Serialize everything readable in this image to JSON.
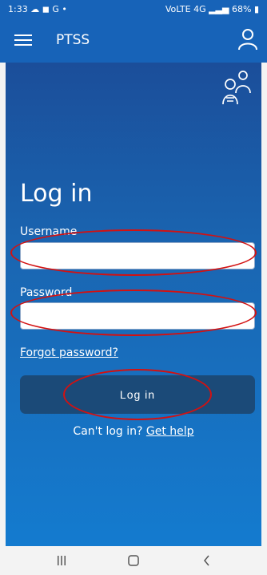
{
  "status_bar": {
    "time": "1:33",
    "icons": [
      "cloud-icon",
      "bag-icon",
      "google-icon",
      "dot-icon"
    ],
    "signal_text": "VoLTE 4G",
    "battery": "68%"
  },
  "app_bar": {
    "title": "PTSS",
    "menu_icon": "hamburger-menu-icon",
    "account_icon": "account-icon"
  },
  "login": {
    "title": "Log in",
    "username_label": "Username",
    "username_value": "",
    "password_label": "Password",
    "password_value": "",
    "forgot_password": "Forgot password?",
    "submit_label": "Log in",
    "help_prefix": "Can't log in?",
    "help_link": "Get help"
  },
  "annotations": {
    "color": "#d31111"
  },
  "colors": {
    "app_bar": "#1763b8",
    "button": "#1b4a78"
  },
  "nav_bar": {
    "icons": [
      "recents-icon",
      "home-icon",
      "back-icon"
    ]
  }
}
